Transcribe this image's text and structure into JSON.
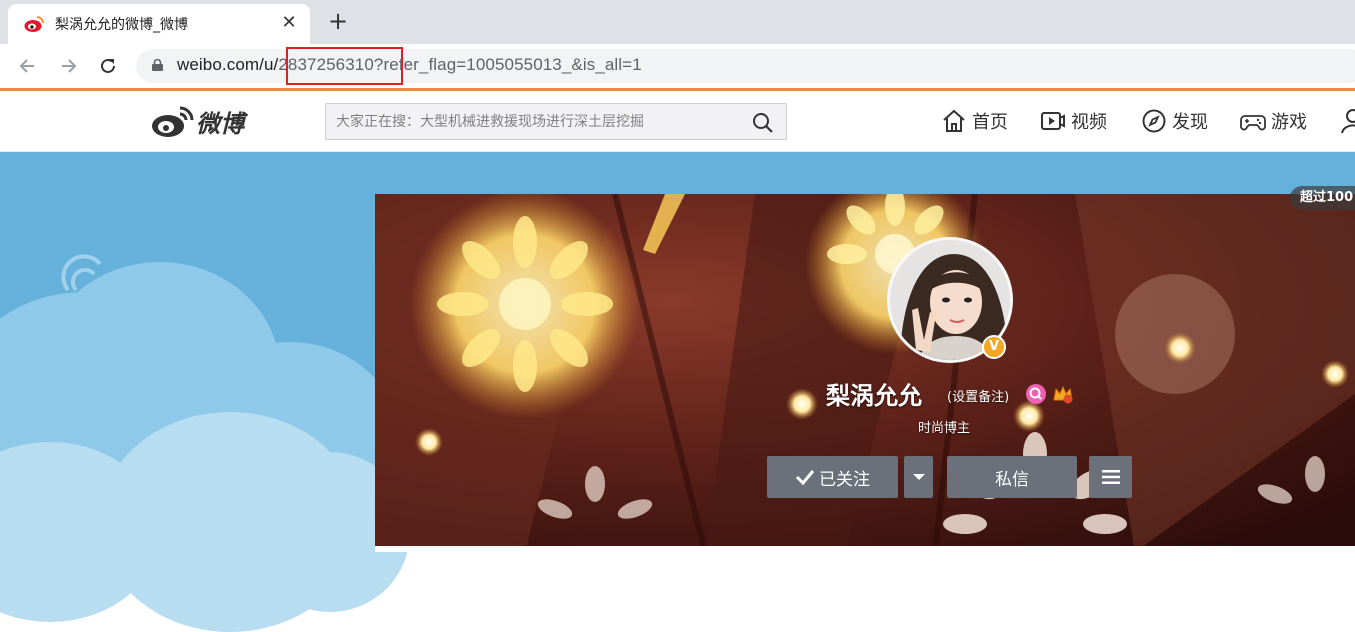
{
  "browser": {
    "tab_title": "梨涡允允的微博_微博",
    "close_glyph": "✕",
    "newtab_glyph": "+",
    "url_host": "weibo.com/u/",
    "url_id": "2837256310",
    "url_rest": "?refer_flag=1005055013_&is_all=1"
  },
  "header": {
    "logo_text": "微博",
    "search_placeholder": "大家正在搜：大型机械进救援现场进行深土层挖掘",
    "nav": [
      {
        "label": "首页",
        "icon": "home-icon"
      },
      {
        "label": "视频",
        "icon": "video-icon"
      },
      {
        "label": "发现",
        "icon": "compass-icon"
      },
      {
        "label": "游戏",
        "icon": "gamepad-icon"
      }
    ]
  },
  "profile": {
    "badge_top": "超过100",
    "name": "梨涡允允",
    "remark": "(设置备注)",
    "subtitle": "时尚博主",
    "verified_glyph": "V",
    "follow_label": "已关注",
    "message_label": "私信"
  },
  "colors": {
    "accent_orange": "#f08a3c",
    "sky_blue": "#65b1dc",
    "button_gray": "#6b707a",
    "highlight_red": "#e02020"
  }
}
